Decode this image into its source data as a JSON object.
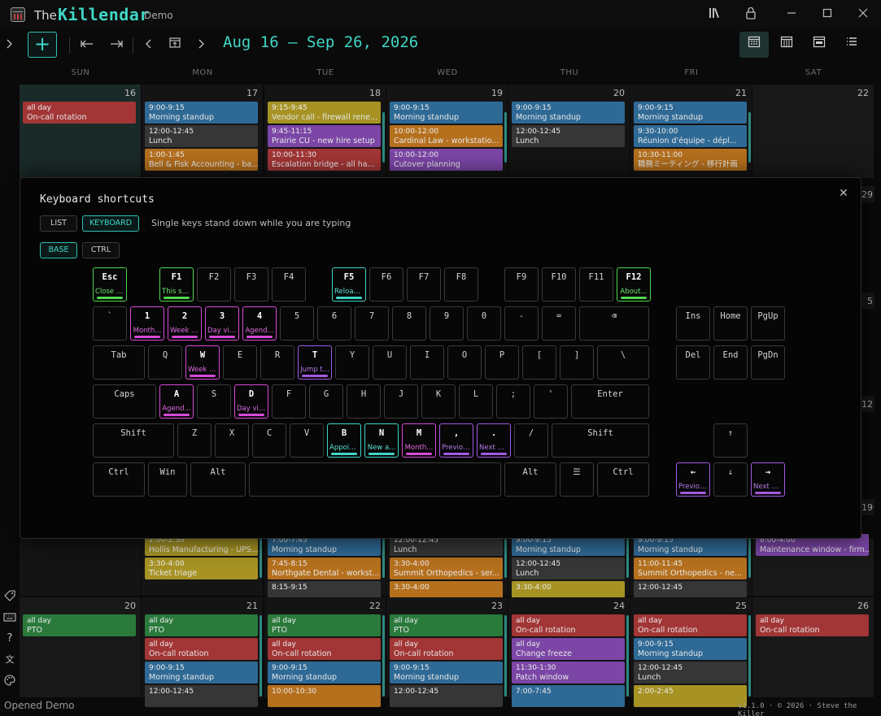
{
  "titlebar": {
    "the": "The",
    "name": "Killendar",
    "badge": "Demo"
  },
  "toolbar": {
    "add_label": "+",
    "date_range": "Aug 16 – Sep 26, 2026"
  },
  "daynames": [
    "SUN",
    "MON",
    "TUE",
    "WED",
    "THU",
    "FRI",
    "SAT"
  ],
  "week1": [
    {
      "num": "16",
      "events": [
        {
          "t": "all day",
          "n": "On-call rotation",
          "c": "red"
        }
      ]
    },
    {
      "num": "17",
      "events": [
        {
          "t": "9:00-9:15",
          "n": "Morning standup",
          "c": "blue"
        },
        {
          "t": "12:00-12:45",
          "n": "Lunch",
          "c": "gray"
        },
        {
          "t": "1:00-1:45",
          "n": "Bell & Fisk Accounting - ba...",
          "c": "orange"
        }
      ]
    },
    {
      "num": "18",
      "events": [
        {
          "t": "9:15-9:45",
          "n": "Vendor call - firewall rene...",
          "c": "yellow"
        },
        {
          "t": "9:45-11:15",
          "n": "Prairie CU - new hire setup",
          "c": "purple"
        },
        {
          "t": "10:00-11:30",
          "n": "Escalation bridge - all ha...",
          "c": "red"
        }
      ]
    },
    {
      "num": "19",
      "events": [
        {
          "t": "9:00-9:15",
          "n": "Morning standup",
          "c": "blue"
        },
        {
          "t": "10:00-12:00",
          "n": "Cardinal Law - workstatio...",
          "c": "orange"
        },
        {
          "t": "10:00-12:00",
          "n": "Cutover planning",
          "c": "purple"
        }
      ]
    },
    {
      "num": "20",
      "events": [
        {
          "t": "9:00-9:15",
          "n": "Morning standup",
          "c": "blue"
        },
        {
          "t": "12:00-12:45",
          "n": "Lunch",
          "c": "gray"
        }
      ]
    },
    {
      "num": "21",
      "events": [
        {
          "t": "9:00-9:15",
          "n": "Morning standup",
          "c": "blue"
        },
        {
          "t": "9:30-10:00",
          "n": "Réunion d'équipe - dépl...",
          "c": "blue"
        },
        {
          "t": "10:30-11:00",
          "n": "職務ミーティング - 移行計画",
          "c": "orange"
        }
      ]
    },
    {
      "num": "22",
      "events": []
    }
  ],
  "week_partial_nums": {
    "sat_a": "29",
    "sat_b": "5",
    "sat_c": "12",
    "sat_d": "19"
  },
  "week4": [
    {
      "events": []
    },
    {
      "events": [
        {
          "t": "2:00-2:30",
          "n": "Hollis Manufacturing - UPS...",
          "c": "yellow"
        },
        {
          "t": "3:30-4:00",
          "n": "Ticket triage",
          "c": "yellow"
        }
      ]
    },
    {
      "events": [
        {
          "t": "7:00-7:45",
          "n": "Morning standup",
          "c": "blue"
        },
        {
          "t": "7:45-8:15",
          "n": "Northgate Dental - workst...",
          "c": "orange"
        },
        {
          "t": "8:15-9:15",
          "n": "",
          "c": "gray"
        }
      ]
    },
    {
      "events": [
        {
          "t": "12:00-12:45",
          "n": "Lunch",
          "c": "gray"
        },
        {
          "t": "3:30-4:00",
          "n": "Summit Orthopedics - ser...",
          "c": "orange"
        },
        {
          "t": "3:30-4:00",
          "n": "",
          "c": "orange"
        }
      ]
    },
    {
      "events": [
        {
          "t": "9:00-9:15",
          "n": "Morning standup",
          "c": "blue"
        },
        {
          "t": "12:00-12:45",
          "n": "Lunch",
          "c": "gray"
        },
        {
          "t": "3:30-4:00",
          "n": "",
          "c": "yellow"
        }
      ]
    },
    {
      "events": [
        {
          "t": "9:00-9:15",
          "n": "Morning standup",
          "c": "blue"
        },
        {
          "t": "11:00-11:45",
          "n": "Summit Orthopedics - ne...",
          "c": "orange"
        },
        {
          "t": "12:00-12:45",
          "n": "",
          "c": "gray"
        }
      ]
    },
    {
      "events": [
        {
          "t": "8:00-4:00",
          "n": "Maintenance window - firm...",
          "c": "purple"
        }
      ]
    }
  ],
  "week5": [
    {
      "num": "20",
      "events": [
        {
          "t": "all day",
          "n": "PTO",
          "c": "green"
        }
      ]
    },
    {
      "num": "21",
      "events": [
        {
          "t": "all day",
          "n": "PTO",
          "c": "green"
        },
        {
          "t": "all day",
          "n": "On-call rotation",
          "c": "red"
        },
        {
          "t": "9:00-9:15",
          "n": "Morning standup",
          "c": "blue"
        },
        {
          "t": "12:00-12:45",
          "n": "",
          "c": "gray"
        }
      ]
    },
    {
      "num": "22",
      "events": [
        {
          "t": "all day",
          "n": "PTO",
          "c": "green"
        },
        {
          "t": "all day",
          "n": "On-call rotation",
          "c": "red"
        },
        {
          "t": "9:00-9:15",
          "n": "Morning standup",
          "c": "blue"
        },
        {
          "t": "10:00-10:30",
          "n": "",
          "c": "orange"
        }
      ]
    },
    {
      "num": "23",
      "events": [
        {
          "t": "all day",
          "n": "PTO",
          "c": "green"
        },
        {
          "t": "all day",
          "n": "On-call rotation",
          "c": "red"
        },
        {
          "t": "9:00-9:15",
          "n": "Morning standup",
          "c": "blue"
        },
        {
          "t": "12:00-12:45",
          "n": "",
          "c": "gray"
        }
      ]
    },
    {
      "num": "24",
      "events": [
        {
          "t": "all day",
          "n": "On-call rotation",
          "c": "red"
        },
        {
          "t": "all day",
          "n": "Change freeze",
          "c": "purple"
        },
        {
          "t": "11:30-1:30",
          "n": "Patch window",
          "c": "purple"
        },
        {
          "t": "7:00-7:45",
          "n": "",
          "c": "blue"
        }
      ]
    },
    {
      "num": "25",
      "events": [
        {
          "t": "all day",
          "n": "On-call rotation",
          "c": "red"
        },
        {
          "t": "9:00-9:15",
          "n": "Morning standup",
          "c": "blue"
        },
        {
          "t": "12:00-12:45",
          "n": "Lunch",
          "c": "gray"
        },
        {
          "t": "2:00-2:45",
          "n": "",
          "c": "yellow"
        }
      ]
    },
    {
      "num": "26",
      "events": [
        {
          "t": "all day",
          "n": "On-call rotation",
          "c": "red"
        }
      ]
    }
  ],
  "footer": {
    "status": "Opened Demo",
    "version": "v1.1.0 · © 2026 · Steve the Killer"
  },
  "modal": {
    "title": "Keyboard shortcuts",
    "tab_list": "LIST",
    "tab_keyboard": "KEYBOARD",
    "hint": "Single keys stand down while you are typing",
    "mod_base": "BASE",
    "mod_ctrl": "CTRL",
    "close": "✕",
    "keys": [
      {
        "cap": "Esc",
        "sub": "Close t...",
        "c": "green"
      },
      {
        "cap": "F1",
        "sub": "This sh...",
        "c": "green"
      },
      {
        "cap": "F2",
        "sub": ""
      },
      {
        "cap": "F3",
        "sub": ""
      },
      {
        "cap": "F4",
        "sub": ""
      },
      {
        "cap": "F5",
        "sub": "Reload...",
        "c": "cyan"
      },
      {
        "cap": "F6",
        "sub": ""
      },
      {
        "cap": "F7",
        "sub": ""
      },
      {
        "cap": "F8",
        "sub": ""
      },
      {
        "cap": "F9",
        "sub": ""
      },
      {
        "cap": "F10",
        "sub": ""
      },
      {
        "cap": "F11",
        "sub": ""
      },
      {
        "cap": "F12",
        "sub": "About...",
        "c": "green"
      },
      {
        "cap": "`",
        "sub": ""
      },
      {
        "cap": "1",
        "sub": "Month...",
        "c": "magenta"
      },
      {
        "cap": "2",
        "sub": "Week v...",
        "c": "magenta"
      },
      {
        "cap": "3",
        "sub": "Day view",
        "c": "magenta"
      },
      {
        "cap": "4",
        "sub": "Agend...",
        "c": "magenta"
      },
      {
        "cap": "5",
        "sub": ""
      },
      {
        "cap": "6",
        "sub": ""
      },
      {
        "cap": "7",
        "sub": ""
      },
      {
        "cap": "8",
        "sub": ""
      },
      {
        "cap": "9",
        "sub": ""
      },
      {
        "cap": "0",
        "sub": ""
      },
      {
        "cap": "-",
        "sub": ""
      },
      {
        "cap": "=",
        "sub": ""
      },
      {
        "cap": "⌫",
        "sub": ""
      },
      {
        "cap": "Ins",
        "sub": ""
      },
      {
        "cap": "Home",
        "sub": ""
      },
      {
        "cap": "PgUp",
        "sub": ""
      },
      {
        "cap": "Tab",
        "sub": ""
      },
      {
        "cap": "Q",
        "sub": ""
      },
      {
        "cap": "W",
        "sub": "Week v...",
        "c": "magenta"
      },
      {
        "cap": "E",
        "sub": ""
      },
      {
        "cap": "R",
        "sub": ""
      },
      {
        "cap": "T",
        "sub": "Jump t...",
        "c": "violet"
      },
      {
        "cap": "Y",
        "sub": ""
      },
      {
        "cap": "U",
        "sub": ""
      },
      {
        "cap": "I",
        "sub": ""
      },
      {
        "cap": "O",
        "sub": ""
      },
      {
        "cap": "P",
        "sub": ""
      },
      {
        "cap": "[",
        "sub": ""
      },
      {
        "cap": "]",
        "sub": ""
      },
      {
        "cap": "\\",
        "sub": ""
      },
      {
        "cap": "Del",
        "sub": ""
      },
      {
        "cap": "End",
        "sub": ""
      },
      {
        "cap": "PgDn",
        "sub": ""
      },
      {
        "cap": "Caps",
        "sub": ""
      },
      {
        "cap": "A",
        "sub": "Agend...",
        "c": "magenta"
      },
      {
        "cap": "S",
        "sub": ""
      },
      {
        "cap": "D",
        "sub": "Day view",
        "c": "magenta"
      },
      {
        "cap": "F",
        "sub": ""
      },
      {
        "cap": "G",
        "sub": ""
      },
      {
        "cap": "H",
        "sub": ""
      },
      {
        "cap": "J",
        "sub": ""
      },
      {
        "cap": "K",
        "sub": ""
      },
      {
        "cap": "L",
        "sub": ""
      },
      {
        "cap": ";",
        "sub": ""
      },
      {
        "cap": "'",
        "sub": ""
      },
      {
        "cap": "Enter",
        "sub": ""
      },
      {
        "cap": "Shift",
        "sub": ""
      },
      {
        "cap": "Z",
        "sub": ""
      },
      {
        "cap": "X",
        "sub": ""
      },
      {
        "cap": "C",
        "sub": ""
      },
      {
        "cap": "V",
        "sub": ""
      },
      {
        "cap": "B",
        "sub": "Appoin...",
        "c": "cyan"
      },
      {
        "cap": "N",
        "sub": "New a...",
        "c": "cyan"
      },
      {
        "cap": "M",
        "sub": "Month...",
        "c": "magenta"
      },
      {
        "cap": ",",
        "sub": "Previou...",
        "c": "violet"
      },
      {
        "cap": ".",
        "sub": "Next m...",
        "c": "violet"
      },
      {
        "cap": "/",
        "sub": ""
      },
      {
        "cap": "Shift",
        "sub": ""
      },
      {
        "cap": "↑",
        "sub": ""
      },
      {
        "cap": "Ctrl",
        "sub": ""
      },
      {
        "cap": "Win",
        "sub": ""
      },
      {
        "cap": "Alt",
        "sub": ""
      },
      {
        "cap": "",
        "sub": ""
      },
      {
        "cap": "Alt",
        "sub": ""
      },
      {
        "cap": "☰",
        "sub": ""
      },
      {
        "cap": "Ctrl",
        "sub": ""
      },
      {
        "cap": "←",
        "sub": "Previou...",
        "c": "violet"
      },
      {
        "cap": "↓",
        "sub": ""
      },
      {
        "cap": "→",
        "sub": "Next m...",
        "c": "violet"
      }
    ]
  }
}
